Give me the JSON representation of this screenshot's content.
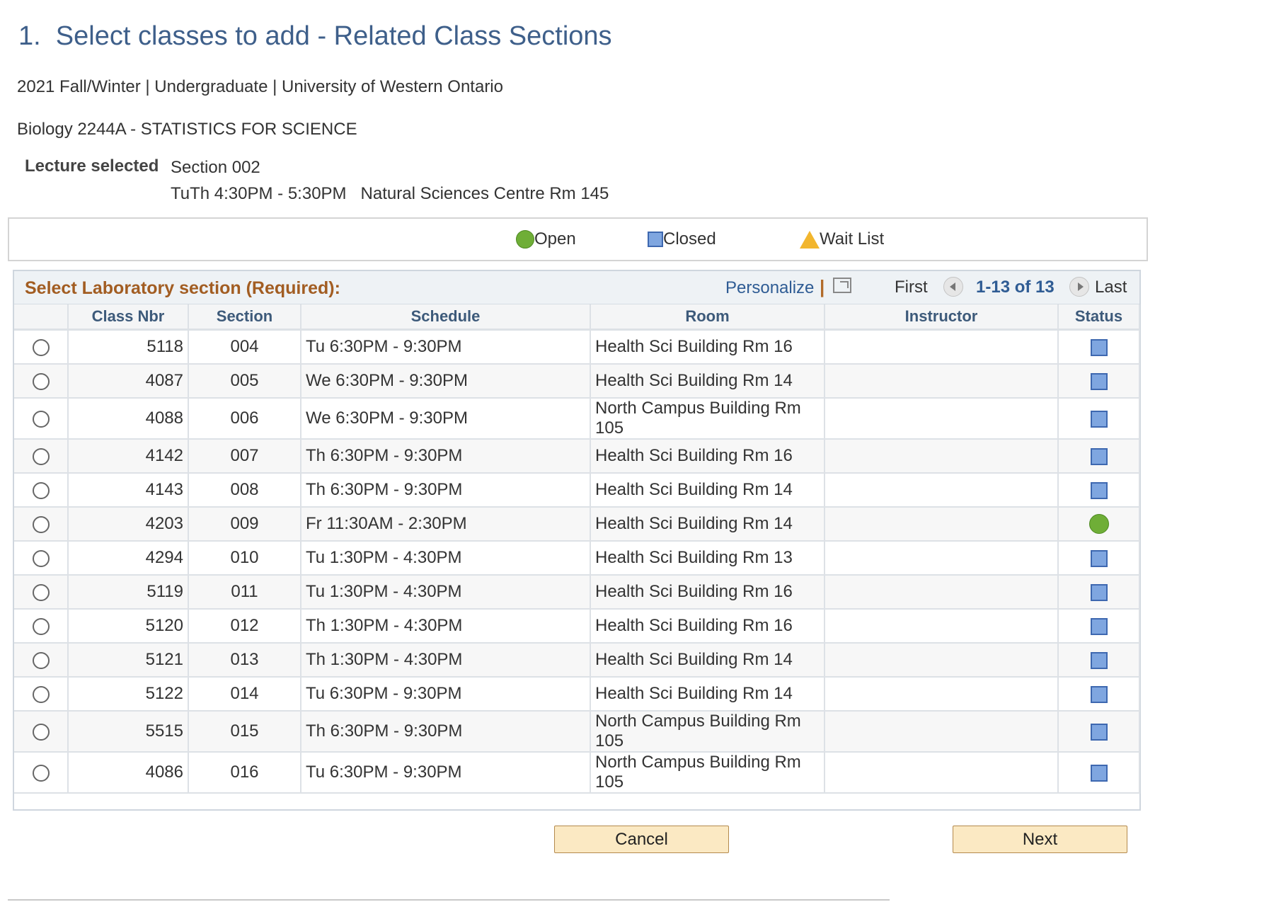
{
  "page": {
    "title": "1.  Select classes to add - Related Class Sections",
    "term": "2021 Fall/Winter | Undergraduate | University of Western Ontario",
    "course": "Biology 2244A - STATISTICS FOR SCIENCE"
  },
  "lecture": {
    "label": "Lecture selected",
    "section": "Section 002",
    "schedule": "TuTh 4:30PM - 5:30PM   Natural Sciences Centre Rm 145"
  },
  "legend": {
    "open": "Open",
    "closed": "Closed",
    "waitlist": "Wait List"
  },
  "grid": {
    "title": "Select Laboratory section (Required):",
    "personalize": "Personalize",
    "separator": "|",
    "first": "First",
    "range": "1-13 of 13",
    "last": "Last",
    "columns": [
      "",
      "Class Nbr",
      "Section",
      "Schedule",
      "Room",
      "Instructor",
      "Status"
    ],
    "rows": [
      {
        "nbr": "5118",
        "section": "004",
        "schedule": "Tu 6:30PM - 9:30PM",
        "room": "Health Sci Building Rm 16",
        "instructor": "",
        "status": "closed"
      },
      {
        "nbr": "4087",
        "section": "005",
        "schedule": "We 6:30PM - 9:30PM",
        "room": "Health Sci Building Rm 14",
        "instructor": "",
        "status": "closed"
      },
      {
        "nbr": "4088",
        "section": "006",
        "schedule": "We 6:30PM - 9:30PM",
        "room": "North Campus Building Rm 105",
        "instructor": "",
        "status": "closed"
      },
      {
        "nbr": "4142",
        "section": "007",
        "schedule": "Th 6:30PM - 9:30PM",
        "room": "Health Sci Building Rm 16",
        "instructor": "",
        "status": "closed"
      },
      {
        "nbr": "4143",
        "section": "008",
        "schedule": "Th 6:30PM - 9:30PM",
        "room": "Health Sci Building Rm 14",
        "instructor": "",
        "status": "closed"
      },
      {
        "nbr": "4203",
        "section": "009",
        "schedule": "Fr 11:30AM - 2:30PM",
        "room": "Health Sci Building Rm 14",
        "instructor": "",
        "status": "open"
      },
      {
        "nbr": "4294",
        "section": "010",
        "schedule": "Tu 1:30PM - 4:30PM",
        "room": "Health Sci Building Rm 13",
        "instructor": "",
        "status": "closed"
      },
      {
        "nbr": "5119",
        "section": "011",
        "schedule": "Tu 1:30PM - 4:30PM",
        "room": "Health Sci Building Rm 16",
        "instructor": "",
        "status": "closed"
      },
      {
        "nbr": "5120",
        "section": "012",
        "schedule": "Th 1:30PM - 4:30PM",
        "room": "Health Sci Building Rm 16",
        "instructor": "",
        "status": "closed"
      },
      {
        "nbr": "5121",
        "section": "013",
        "schedule": "Th 1:30PM - 4:30PM",
        "room": "Health Sci Building Rm 14",
        "instructor": "",
        "status": "closed"
      },
      {
        "nbr": "5122",
        "section": "014",
        "schedule": "Tu 6:30PM - 9:30PM",
        "room": "Health Sci Building Rm 14",
        "instructor": "",
        "status": "closed"
      },
      {
        "nbr": "5515",
        "section": "015",
        "schedule": "Th 6:30PM - 9:30PM",
        "room": "North Campus Building Rm 105",
        "instructor": "",
        "status": "closed"
      },
      {
        "nbr": "4086",
        "section": "016",
        "schedule": "Tu 6:30PM - 9:30PM",
        "room": "North Campus Building Rm 105",
        "instructor": "",
        "status": "closed"
      }
    ]
  },
  "buttons": {
    "cancel": "Cancel",
    "next": "Next"
  },
  "colors": {
    "title": "#3e5f8a",
    "grid_title": "#a25d22",
    "link": "#2f5c94",
    "open": "#6fae37",
    "closed": "#7fa6e0",
    "waitlist": "#f2b62e",
    "button_bg": "#fbe9c3"
  },
  "icons": {
    "open": "green-circle-icon",
    "closed": "blue-square-icon",
    "waitlist": "yellow-triangle-icon"
  }
}
